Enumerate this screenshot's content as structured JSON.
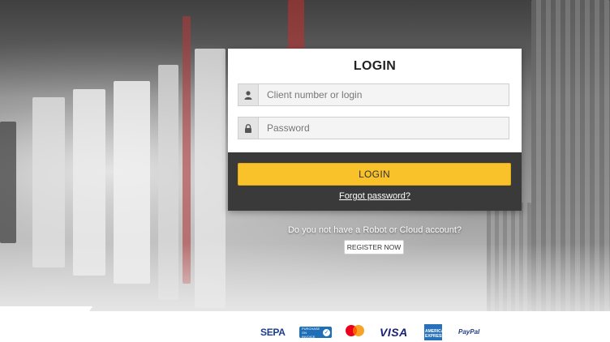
{
  "login": {
    "title": "LOGIN",
    "client_placeholder": "Client number or login",
    "password_placeholder": "Password",
    "submit_label": "LOGIN",
    "forgot_label": "Forgot password?"
  },
  "register": {
    "prompt": "Do you not have a Robot or Cloud account?",
    "button_label": "REGISTER NOW"
  },
  "payment_methods": {
    "sepa": "SEPA",
    "invoice": "PURCHASE ON INVOICE",
    "mastercard": "mastercard",
    "visa": "VISA",
    "amex": "AMERICAN EXPRESS",
    "paypal": "PayPal"
  },
  "colors": {
    "accent": "#f9c22a",
    "footer_dark": "#3a3a3a"
  },
  "icons": {
    "user": "user-icon",
    "lock": "lock-icon"
  }
}
